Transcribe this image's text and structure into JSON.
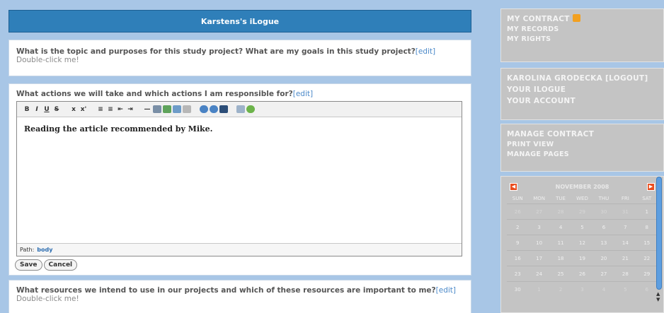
{
  "header": {
    "title": "Karstens's iLogue"
  },
  "q1": {
    "title": "What is the topic and purposes for this study project? What are my goals in this study project?",
    "edit": "[edit]",
    "placeholder": "Double-click me!"
  },
  "q2": {
    "title": "What actions we will take and which actions I am responsible for?",
    "edit": "[edit]",
    "toolbar": [
      "B",
      "I",
      "U",
      "S",
      "x",
      "x'",
      "≡",
      "≡",
      "⇤",
      "⇥",
      "—"
    ],
    "content": "Reading the article recommended by Mike.",
    "path_label": "Path:",
    "path_value": "body",
    "save": "Save",
    "cancel": "Cancel"
  },
  "q3": {
    "title": "What resources we intend to use in our projects and which of these resources are important to me?",
    "edit": "[edit]",
    "placeholder": "Double-click me!"
  },
  "sidebar": {
    "box1": [
      "MY CONTRACT",
      "MY RECORDS",
      "MY RIGHTS"
    ],
    "box2": {
      "user": "KAROLINA GRODECKA",
      "logout": "[LOGOUT]",
      "items": [
        "YOUR ILOGUE",
        "YOUR ACCOUNT"
      ]
    },
    "box3": [
      "MANAGE CONTRACT",
      "PRINT VIEW",
      "MANAGE PAGES"
    ],
    "calendar": {
      "month": "NOVEMBER 2008",
      "dow": [
        "SUN",
        "MON",
        "TUE",
        "WED",
        "THU",
        "FRI",
        "SAT"
      ],
      "rows": [
        [
          "26",
          "27",
          "28",
          "29",
          "30",
          "31",
          "1"
        ],
        [
          "2",
          "3",
          "4",
          "5",
          "6",
          "7",
          "8"
        ],
        [
          "9",
          "10",
          "11",
          "12",
          "13",
          "14",
          "15"
        ],
        [
          "16",
          "17",
          "18",
          "19",
          "20",
          "21",
          "22"
        ],
        [
          "23",
          "24",
          "25",
          "26",
          "27",
          "28",
          "29"
        ],
        [
          "30",
          "1",
          "2",
          "3",
          "4",
          "5",
          "6"
        ]
      ]
    }
  },
  "colors": {
    "header_bar": "#2f7fb9",
    "sidebar_box": "#c4c4c4",
    "background": "#a8c6e6",
    "rss": "#f2a020",
    "cal_arrow": "#e94d1e"
  }
}
